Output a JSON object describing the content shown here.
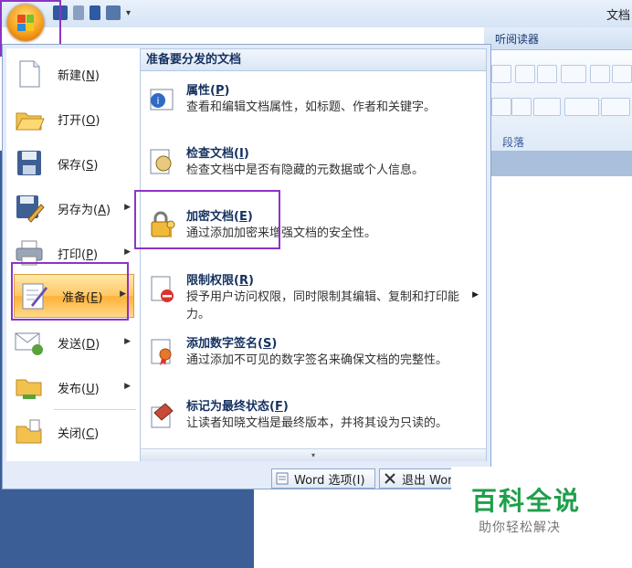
{
  "window": {
    "title": "文档"
  },
  "ribbon": {
    "tab_label": "听阅读器",
    "group_label": "段落"
  },
  "menu": {
    "left_items": [
      {
        "label": "新建",
        "key": "N"
      },
      {
        "label": "打开",
        "key": "O"
      },
      {
        "label": "保存",
        "key": "S"
      },
      {
        "label": "另存为",
        "key": "A"
      },
      {
        "label": "打印",
        "key": "P"
      },
      {
        "label": "准备",
        "key": "E"
      },
      {
        "label": "发送",
        "key": "D"
      },
      {
        "label": "发布",
        "key": "U"
      },
      {
        "label": "关闭",
        "key": "C"
      }
    ],
    "submenu": {
      "header": "准备要分发的文档",
      "items": [
        {
          "title": "属性",
          "key": "P",
          "desc": "查看和编辑文档属性，如标题、作者和关键字。"
        },
        {
          "title": "检查文档",
          "key": "I",
          "desc": "检查文档中是否有隐藏的元数据或个人信息。"
        },
        {
          "title": "加密文档",
          "key": "E",
          "desc": "通过添加加密来增强文档的安全性。"
        },
        {
          "title": "限制权限",
          "key": "R",
          "desc": "授予用户访问权限，同时限制其编辑、复制和打印能力。"
        },
        {
          "title": "添加数字签名",
          "key": "S",
          "desc": "通过添加不可见的数字签名来确保文档的完整性。"
        },
        {
          "title": "标记为最终状态",
          "key": "F",
          "desc": "让读者知晓文档是最终版本，并将其设为只读的。"
        }
      ]
    },
    "footer": {
      "options_label": "Word 选项(I)",
      "exit_label": "退出 Word"
    }
  },
  "watermark": {
    "title": "百科全说",
    "subtitle": "助你轻松解决"
  },
  "colors": {
    "highlight_outline": "#8c33c8",
    "accent": "#ffc764",
    "watermark_green": "#1f9f4b"
  }
}
